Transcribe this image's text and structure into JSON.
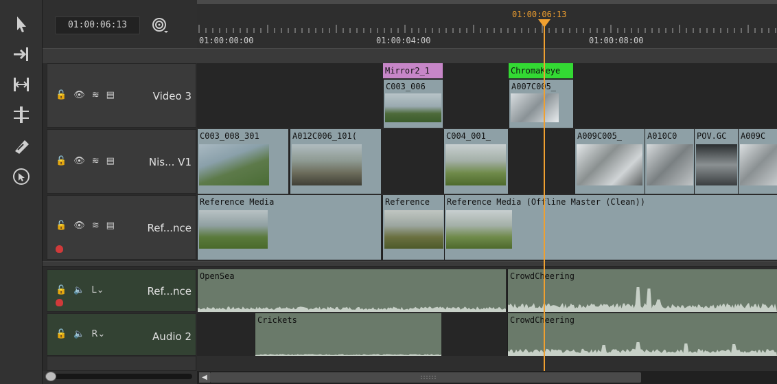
{
  "toolbar": {
    "tools": [
      {
        "icon": "pointer-arrow-icon"
      },
      {
        "icon": "track-select-icon"
      },
      {
        "icon": "slip-trim-icon"
      },
      {
        "icon": "slide-icon"
      },
      {
        "icon": "razor-icon"
      },
      {
        "icon": "multi-tool-icon"
      }
    ]
  },
  "timecode": {
    "current": "01:00:06:13",
    "playhead_label": "01:00:06:13",
    "ruler_labels": [
      "01:00:00:00",
      "01:00:04:00",
      "01:00:08:00"
    ]
  },
  "tracks": [
    {
      "name": "Video 3",
      "kind": "video"
    },
    {
      "name": "Nis... V1",
      "kind": "video"
    },
    {
      "name": "Ref...nce",
      "kind": "video"
    },
    {
      "name": "Ref...nce",
      "kind": "audio",
      "channel": "L"
    },
    {
      "name": "Audio 2",
      "kind": "audio",
      "channel": "R"
    }
  ],
  "clips": {
    "video3": [
      {
        "tag": "Mirror2_1",
        "label": "C003_006",
        "tag_color": "#c786c8"
      },
      {
        "tag": "ChromaKeye",
        "label": "A007C005_",
        "tag_color": "#33d933"
      }
    ],
    "v1": [
      {
        "label": "C003_008_301"
      },
      {
        "label": "A012C006_101("
      },
      {
        "label": "C004_001_"
      },
      {
        "label": "A009C005_"
      },
      {
        "label": "A010C0"
      },
      {
        "label": "POV.GC"
      },
      {
        "label": "A009C"
      }
    ],
    "reference": [
      {
        "label": "Reference Media"
      },
      {
        "label": "Reference"
      },
      {
        "label": "Reference Media (Offline Master (Clean))"
      }
    ],
    "audio1": [
      {
        "label": "OpenSea"
      },
      {
        "label": "CrowdCheering"
      }
    ],
    "audio2": [
      {
        "label": "Crickets"
      },
      {
        "label": "CrowdCheering"
      }
    ]
  },
  "colors": {
    "playhead": "#f0a030",
    "video_clip": "#8ea0a6",
    "audio_clip": "#6a7a6a",
    "audio_header": "#334233"
  }
}
